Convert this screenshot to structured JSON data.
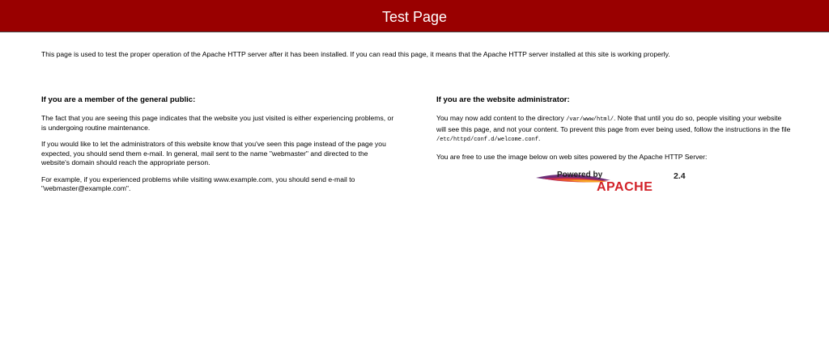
{
  "header": {
    "title": "Test Page"
  },
  "intro": {
    "text": "This page is used to test the proper operation of the Apache HTTP server after it has been installed. If you can read this page, it means that the Apache HTTP server installed at this site is working properly."
  },
  "public": {
    "heading": "If you are a member of the general public:",
    "p1": "The fact that you are seeing this page indicates that the website you just visited is either experiencing problems, or is undergoing routine maintenance.",
    "p2": "If you would like to let the administrators of this website know that you've seen this page instead of the page you expected, you should send them e-mail. In general, mail sent to the name \"webmaster\" and directed to the website's domain should reach the appropriate person.",
    "p3": "For example, if you experienced problems while visiting www.example.com, you should send e-mail to \"webmaster@example.com\"."
  },
  "admin": {
    "heading": "If you are the website administrator:",
    "p1_a": "You may now add content to the directory ",
    "p1_dir": "/var/www/html/",
    "p1_b": ". Note that until you do so, people visiting your website will see this page, and not your content. To prevent this page from ever being used, follow the instructions in the file ",
    "p1_file": "/etc/httpd/conf.d/welcome.conf",
    "p1_c": ".",
    "p2": "You are free to use the image below on web sites powered by the Apache HTTP Server:"
  },
  "logo": {
    "powered_by": "Powered by",
    "brand": "APACHE",
    "version": "2.4"
  },
  "colors": {
    "header_bg": "#990000",
    "header_text": "#ffffff",
    "logo_text_red": "#d22128",
    "logo_feather_purple": "#6d2e78"
  }
}
